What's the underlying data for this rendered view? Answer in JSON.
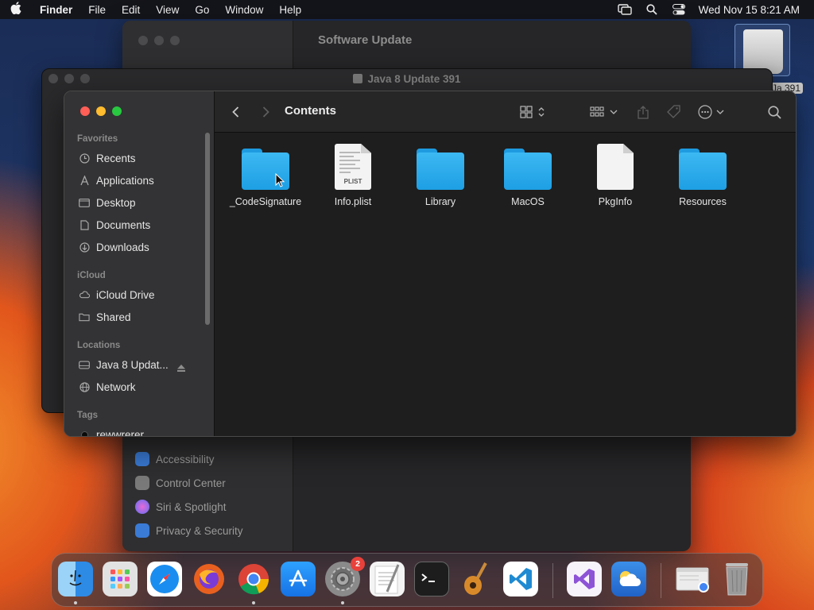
{
  "menubar": {
    "app_name": "Finder",
    "items": [
      "File",
      "Edit",
      "View",
      "Go",
      "Window",
      "Help"
    ],
    "clock": "Wed Nov 15  8:21 AM",
    "status_icons": [
      "screen-mirroring-icon",
      "spotlight-search-icon",
      "control-center-icon"
    ]
  },
  "settings_window": {
    "title": "Software Update",
    "sidebar_items": [
      {
        "label": "Accessibility",
        "icon": "accessibility-icon",
        "color": "#3a7bd5"
      },
      {
        "label": "Control Center",
        "icon": "control-center-icon",
        "color": "#7a7a7a"
      },
      {
        "label": "Siri & Spotlight",
        "icon": "siri-icon",
        "color": "#b04ad8"
      },
      {
        "label": "Privacy & Security",
        "icon": "hand-icon",
        "color": "#3a7bd5"
      }
    ]
  },
  "java_window": {
    "title": "Java 8 Update 391"
  },
  "desktop": {
    "disk_label": "Ja 391"
  },
  "finder": {
    "title": "Contents",
    "sidebar": {
      "favorites_header": "Favorites",
      "favorites": [
        {
          "label": "Recents",
          "icon": "clock-icon"
        },
        {
          "label": "Applications",
          "icon": "applications-icon"
        },
        {
          "label": "Desktop",
          "icon": "desktop-icon"
        },
        {
          "label": "Documents",
          "icon": "document-icon"
        },
        {
          "label": "Downloads",
          "icon": "download-icon"
        }
      ],
      "icloud_header": "iCloud",
      "icloud": [
        {
          "label": "iCloud Drive",
          "icon": "cloud-icon"
        },
        {
          "label": "Shared",
          "icon": "shared-folder-icon"
        }
      ],
      "locations_header": "Locations",
      "locations": [
        {
          "label": "Java 8 Updat...",
          "icon": "disk-icon"
        },
        {
          "label": "Network",
          "icon": "globe-icon"
        }
      ],
      "tags_header": "Tags",
      "tags": [
        {
          "label": "rewwrerer",
          "icon": "tag-dot-icon"
        }
      ]
    },
    "files": [
      {
        "name": "_CodeSignature",
        "kind": "folder"
      },
      {
        "name": "Info.plist",
        "kind": "plist",
        "tag": "PLIST"
      },
      {
        "name": "Library",
        "kind": "folder"
      },
      {
        "name": "MacOS",
        "kind": "folder"
      },
      {
        "name": "PkgInfo",
        "kind": "document"
      },
      {
        "name": "Resources",
        "kind": "folder"
      }
    ]
  },
  "dock": {
    "apps": [
      {
        "name": "Finder",
        "icon": "finder-icon",
        "color": "#2d8be6",
        "running": true
      },
      {
        "name": "Launchpad",
        "icon": "launchpad-icon",
        "color": "#d8d8d8",
        "running": false
      },
      {
        "name": "Safari",
        "icon": "safari-icon",
        "color": "#1a8df0",
        "running": false
      },
      {
        "name": "Firefox",
        "icon": "firefox-icon",
        "color": "#e8601f",
        "running": false
      },
      {
        "name": "Chrome",
        "icon": "chrome-icon",
        "color": "#ffffff",
        "running": true
      },
      {
        "name": "App Store",
        "icon": "app-store-icon",
        "color": "#1877f2",
        "running": false
      },
      {
        "name": "System Settings",
        "icon": "settings-gear-icon",
        "color": "#8a8a8a",
        "running": true,
        "badge": "2"
      },
      {
        "name": "TextEdit",
        "icon": "textedit-icon",
        "color": "#f4f4f4",
        "running": false
      },
      {
        "name": "Terminal",
        "icon": "terminal-icon",
        "color": "#1d1d1d",
        "running": false
      },
      {
        "name": "GarageBand",
        "icon": "guitar-icon",
        "color": "#5a3a20",
        "running": false
      },
      {
        "name": "Visual Studio Code",
        "icon": "vscode-icon",
        "color": "#ffffff",
        "running": false
      },
      {
        "name": "Visual Studio",
        "icon": "visual-studio-icon",
        "color": "#f7f3fb",
        "running": false
      },
      {
        "name": "Weather",
        "icon": "weather-icon",
        "color": "#2e7de0",
        "running": false
      },
      {
        "name": "Chrome Window",
        "icon": "browser-window-icon",
        "color": "#e9e9e9",
        "running": false
      },
      {
        "name": "Trash",
        "icon": "trash-icon",
        "color": "#8b8b8b",
        "running": false
      }
    ]
  }
}
